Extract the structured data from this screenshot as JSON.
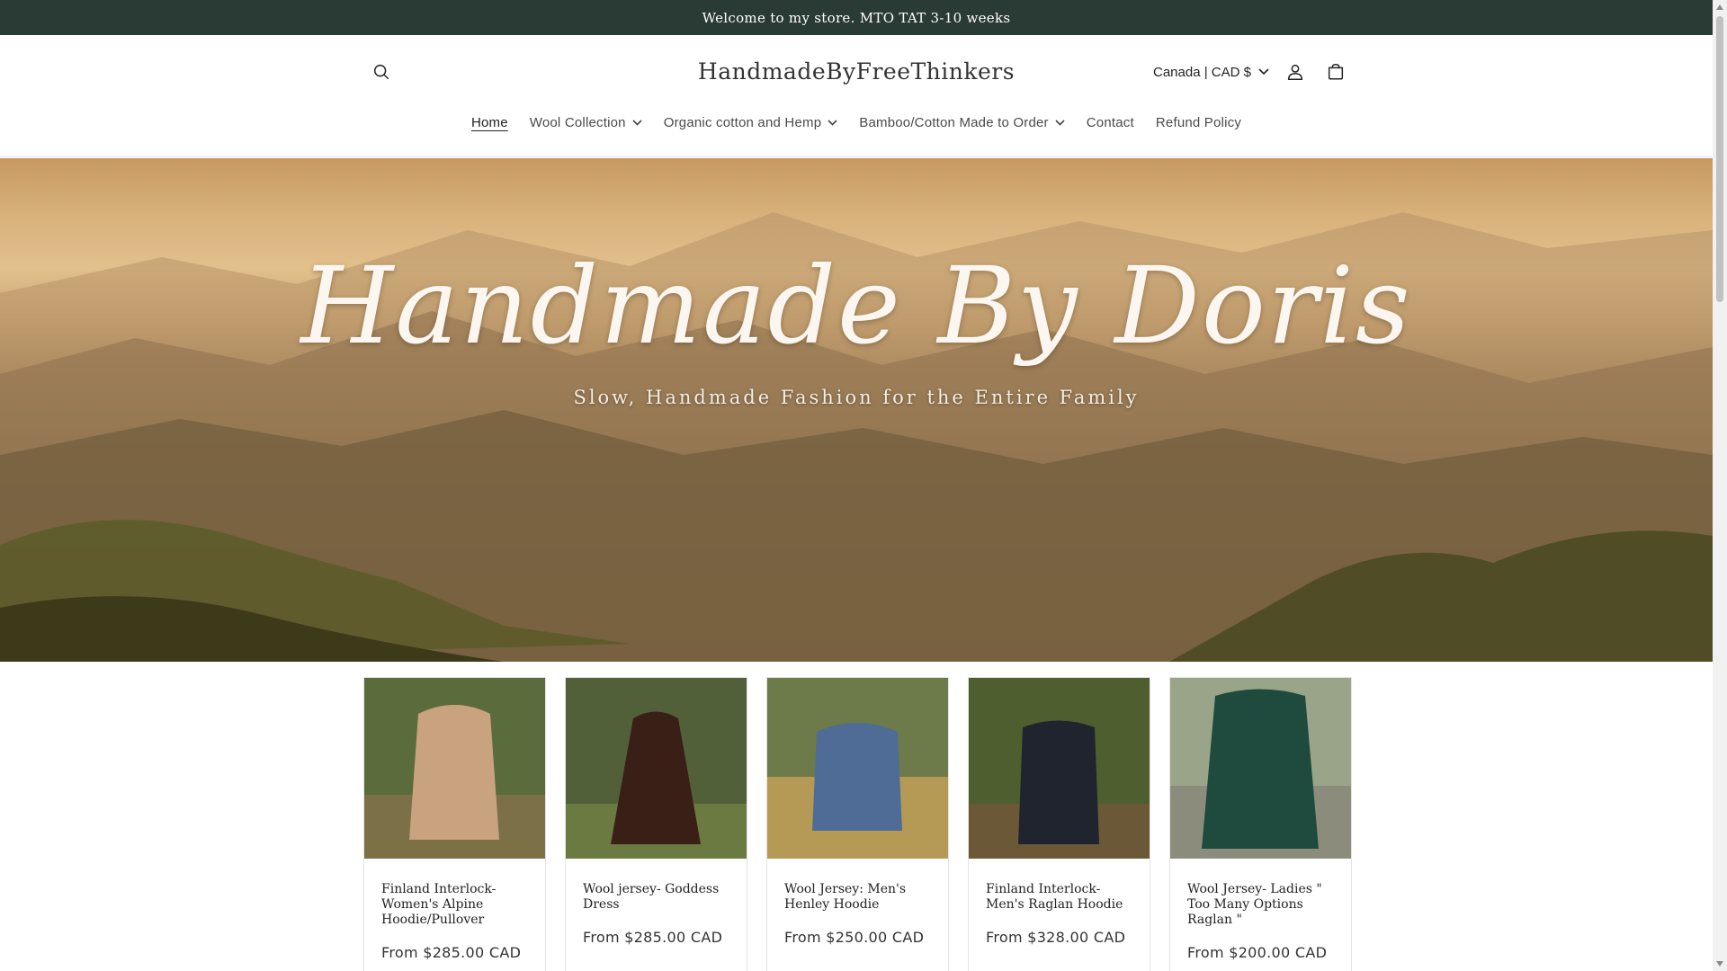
{
  "announcement": {
    "text": "Welcome to my store. MTO TAT 3-10 weeks"
  },
  "header": {
    "store_name": "HandmadeByFreeThinkers",
    "currency": "Canada | CAD $"
  },
  "nav": {
    "items": [
      {
        "label": "Home",
        "active": true,
        "dropdown": false
      },
      {
        "label": "Wool Collection",
        "active": false,
        "dropdown": true
      },
      {
        "label": "Organic cotton and Hemp",
        "active": false,
        "dropdown": true
      },
      {
        "label": "Bamboo/Cotton Made to Order",
        "active": false,
        "dropdown": true
      },
      {
        "label": "Contact",
        "active": false,
        "dropdown": false
      },
      {
        "label": "Refund Policy",
        "active": false,
        "dropdown": false
      }
    ]
  },
  "hero": {
    "title": "Handmade By Doris",
    "subtitle": "Slow, Handmade Fashion for the Entire Family"
  },
  "products": [
    {
      "name": "Finland Interlock- Women's Alpine Hoodie/Pullover",
      "price": "From $285.00 CAD",
      "color": "#c9a27f"
    },
    {
      "name": "Wool jersey- Goddess Dress",
      "price": "From $285.00 CAD",
      "color": "#3a1f17"
    },
    {
      "name": "Wool Jersey: Men's Henley Hoodie",
      "price": "From $250.00 CAD",
      "color": "#4f6c96"
    },
    {
      "name": "Finland Interlock- Men's Raglan Hoodie",
      "price": "From $328.00 CAD",
      "color": "#20242e"
    },
    {
      "name": "Wool Jersey- Ladies \" Too Many Options Raglan \"",
      "price": "From $200.00 CAD",
      "color": "#1f4a3e"
    }
  ],
  "colors": {
    "announcement_bg": "#2a3a34",
    "text": "#121212"
  }
}
